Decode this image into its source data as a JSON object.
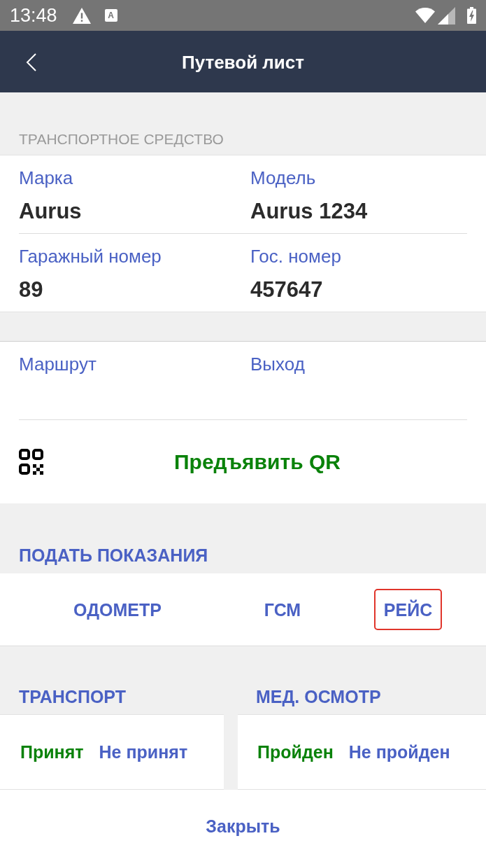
{
  "status_bar": {
    "time": "13:48",
    "notification_letter": "A"
  },
  "app_bar": {
    "title": "Путевой лист"
  },
  "vehicle": {
    "header": "ТРАНСПОРТНОЕ СРЕДСТВО",
    "rows": [
      {
        "fields": [
          {
            "label": "Марка",
            "value": "Aurus"
          },
          {
            "label": "Модель",
            "value": "Aurus 1234"
          }
        ]
      },
      {
        "fields": [
          {
            "label": "Гаражный номер",
            "value": "89"
          },
          {
            "label": "Гос. номер",
            "value": "457647"
          }
        ]
      }
    ]
  },
  "route": {
    "fields": [
      {
        "label": "Маршрут"
      },
      {
        "label": "Выход"
      }
    ]
  },
  "qr_button": {
    "label": "Предъявить QR"
  },
  "readings": {
    "header": "ПОДАТЬ ПОКАЗАНИЯ",
    "tabs": [
      {
        "label": "ОДОМЕТР",
        "selected": false
      },
      {
        "label": "ГСМ",
        "selected": false
      },
      {
        "label": "РЕЙС",
        "selected": true
      }
    ]
  },
  "checks": [
    {
      "header": "ТРАНСПОРТ",
      "options": [
        {
          "label": "Принят",
          "selected": true
        },
        {
          "label": "Не принят",
          "selected": false
        }
      ]
    },
    {
      "header": "МЕД. ОСМОТР",
      "options": [
        {
          "label": "Пройден",
          "selected": true
        },
        {
          "label": "Не пройден",
          "selected": false
        }
      ]
    }
  ],
  "close_button": {
    "label": "Закрыть"
  }
}
